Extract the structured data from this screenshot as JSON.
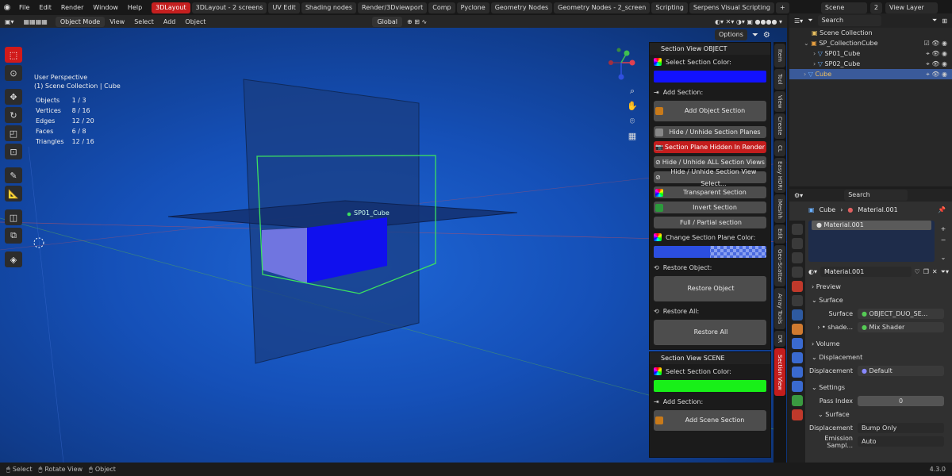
{
  "menubar": {
    "items": [
      "File",
      "Edit",
      "Render",
      "Window",
      "Help"
    ],
    "workspaces": [
      "3DLayout",
      "3DLayout - 2 screens",
      "UV Edit",
      "Shading nodes",
      "Render/3Dviewport",
      "Comp",
      "Pyclone",
      "Geometry Nodes",
      "Geometry Nodes - 2_screen",
      "Scripting",
      "Serpens Visual Scripting"
    ],
    "scene_label": "Scene",
    "scene_num": "2",
    "view_layer": "View Layer"
  },
  "header": {
    "mode": "Object Mode",
    "menus": [
      "View",
      "Select",
      "Add",
      "Object"
    ],
    "orientation": "Global",
    "options": "Options"
  },
  "viewport": {
    "title": "User Perspective",
    "collection": "(1) Scene Collection | Cube",
    "stats": [
      {
        "label": "Objects",
        "value": "1 / 3"
      },
      {
        "label": "Vertices",
        "value": "8 / 16"
      },
      {
        "label": "Edges",
        "value": "12 / 20"
      },
      {
        "label": "Faces",
        "value": "6 / 8"
      },
      {
        "label": "Triangles",
        "value": "12 / 16"
      }
    ],
    "object_label": "SP01_Cube"
  },
  "npanel_object": {
    "title": "Section View OBJECT",
    "select_color": "Select Section Color:",
    "add_section": "Add Section:",
    "add_object_section": "Add Object Section",
    "hide_planes": "Hide / Unhide Section Planes",
    "plane_hidden": "Section Plane Hidden In Render",
    "hide_all": "Hide / Unhide ALL Section Views",
    "hide_selected": "Hide / Unhide Section View Select...",
    "transparent": "Transparent Section",
    "invert": "Invert Section",
    "full_partial": "Full / Partial section",
    "change_plane_color": "Change Section Plane Color:",
    "restore_object_label": "Restore Object:",
    "restore_object": "Restore Object",
    "restore_all_label": "Restore All:",
    "restore_all": "Restore All",
    "section_color": "#1212ff",
    "plane_color": "#2b4ee0"
  },
  "npanel_scene": {
    "title": "Section View SCENE",
    "select_color": "Select Section Color:",
    "add_section": "Add Section:",
    "add_scene_section": "Add Scene Section",
    "section_color": "#18f018"
  },
  "side_tabs": [
    "Item",
    "Tool",
    "View",
    "Create",
    "CL",
    "Easy HDRI",
    "iMeshh",
    "Edit",
    "Geo-Scatter",
    "Array Tools",
    "DR",
    "Section View"
  ],
  "outliner": {
    "search_placeholder": "Search",
    "root": "Scene Collection",
    "items": [
      {
        "name": "SP_CollectionCube",
        "level": 1
      },
      {
        "name": "SP01_Cube",
        "level": 2
      },
      {
        "name": "SP02_Cube",
        "level": 2
      },
      {
        "name": "Cube",
        "level": 1,
        "selected": true
      }
    ]
  },
  "properties": {
    "search_placeholder": "Search",
    "breadcrumb_object": "Cube",
    "breadcrumb_material": "Material.001",
    "slot": "Material.001",
    "material_name": "Material.001",
    "sections": {
      "preview": "Preview",
      "surface": "Surface",
      "volume": "Volume",
      "displacement": "Displacement",
      "settings": "Settings",
      "settings_surface": "Surface"
    },
    "surface_label": "Surface",
    "surface_value": "OBJECT_DUO_SE...",
    "shader_label": "shade...",
    "shader_value": "Mix Shader",
    "displacement_label": "Displacement",
    "displacement_value": "Default",
    "pass_index_label": "Pass Index",
    "pass_index_value": "0",
    "disp_method_label": "Displacement",
    "disp_method_value": "Bump Only",
    "emission_label": "Emission Sampl...",
    "emission_value": "Auto"
  },
  "status": {
    "select": "Select",
    "rotate": "Rotate View",
    "object": "Object",
    "version": "4.3.0"
  }
}
